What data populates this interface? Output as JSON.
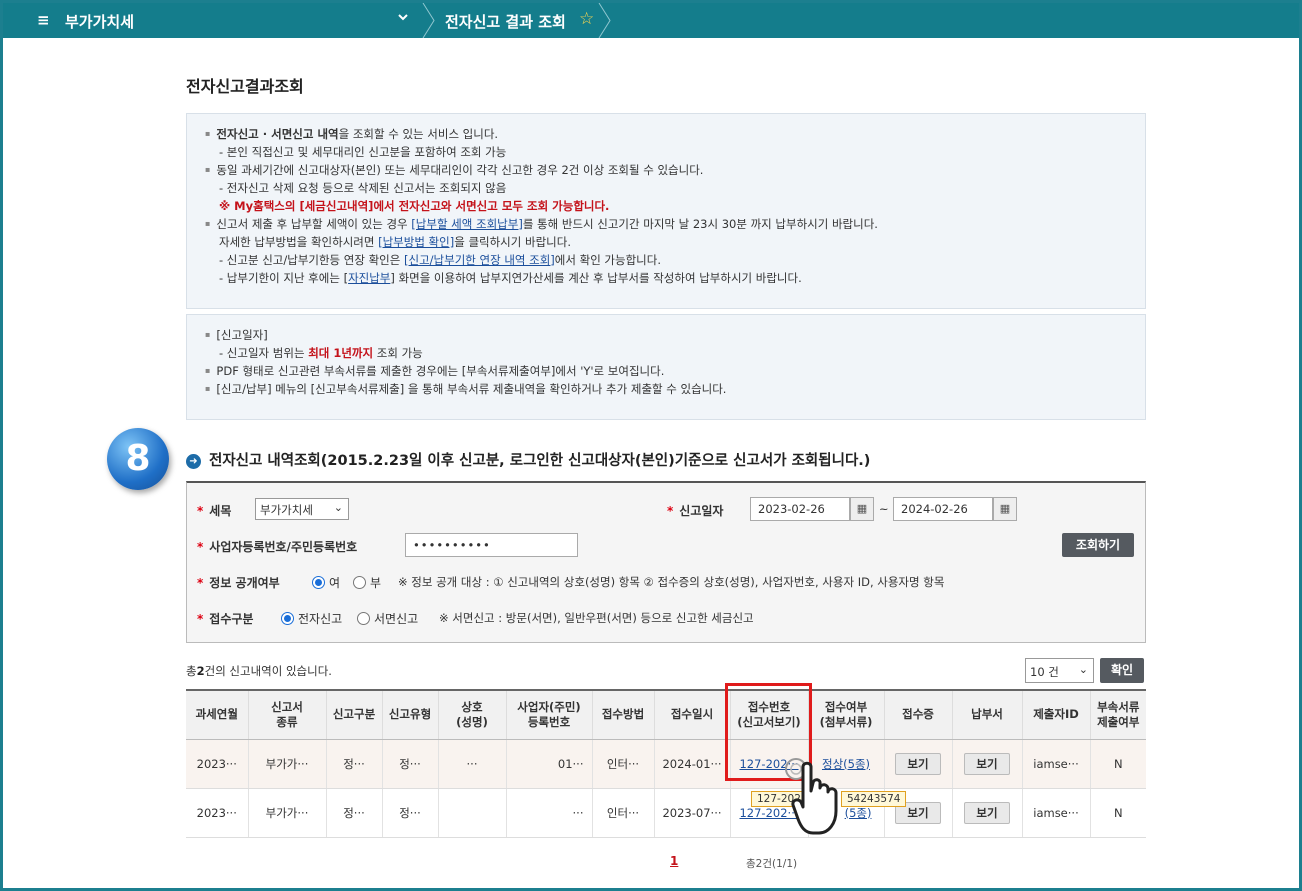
{
  "topbar": {
    "menu_icon": "≡",
    "menu_title": "부가가치세",
    "dropdown_icon": "chevron-down-icon",
    "breadcrumb": "전자신고 결과 조회",
    "star_icon": "☆"
  },
  "page_title": "전자신고결과조회",
  "info1": {
    "l1a": "전자신고 · 서면신고 내역",
    "l1b": "을 조회할 수 있는 서비스 입니다.",
    "l2": "- 본인 직접신고 및 세무대리인 신고분을 포함하여 조회 가능",
    "l3": "동일 과세기간에 신고대상자(본인) 또는 세무대리인이 각각 신고한 경우 2건 이상 조회될 수 있습니다.",
    "l4": "- 전자신고 삭제 요청 등으로 삭제된 신고서는 조회되지 않음",
    "l5": "※ My홈택스의 [세금신고내역]에서 전자신고와 서면신고 모두 조회 가능합니다.",
    "l6a": "신고서 제출 후 납부할 세액이 있는 경우 ",
    "l6link": "[납부할 세액 조회납부]",
    "l6b": "를 통해 반드시 신고기간 마지막 날 23시 30분 까지 납부하시기 바랍니다.",
    "l7a": "자세한 납부방법을 확인하시려면 ",
    "l7link": "[납부방법 확인]",
    "l7b": "을 클릭하시기 바랍니다.",
    "l8a": "- 신고분 신고/납부기한등 연장 확인은 ",
    "l8link": "[신고/납부기한 연장 내역 조회]",
    "l8b": "에서 확인 가능합니다.",
    "l9a": "- 납부기한이 지난 후에는 [",
    "l9link": "자진납부",
    "l9b": "] 화면을 이용하여 납부지연가산세를 계산 후 납부서를 작성하여 납부하시기 바랍니다."
  },
  "info2": {
    "l1": "[신고일자]",
    "l2a": "- 신고일자 범위는 ",
    "l2red": "최대 1년까지",
    "l2b": " 조회 가능",
    "l3": "PDF 형태로 신고관련 부속서류를 제출한 경우에는 [부속서류제출여부]에서 'Y'로 보여집니다.",
    "l4": "[신고/납부] 메뉴의 [신고부속서류제출] 을 통해 부속서류 제출내역을 확인하거나 추가 제출할 수 있습니다."
  },
  "step_badge": "8",
  "section_title": "전자신고 내역조회(2015.2.23일 이후 신고분, 로그인한  신고대상자(본인)기준으로  신고서가 조회됩니다.)",
  "search": {
    "tax_label": "세목",
    "tax_value": "부가가치세",
    "date_label": "신고일자",
    "date_from": "2023-02-26",
    "date_tilde": "~",
    "date_to": "2024-02-26",
    "bizno_label": "사업자등록번호/주민등록번호",
    "bizno_value": "••••••••••",
    "search_button": "조회하기",
    "disclose_label": "정보 공개여부",
    "disclose_yes": "여",
    "disclose_no": "부",
    "disclose_note": "※ 정보 공개 대상 : ① 신고내역의 상호(성명) 항목 ② 접수증의 상호(성명), 사업자번호, 사용자 ID, 사용자명 항목",
    "receipt_label": "접수구분",
    "receipt_e": "전자신고",
    "receipt_paper": "서면신고",
    "receipt_note": "※ 서면신고 : 방문(서면), 일반우편(서면) 등으로 신고한 세금신고"
  },
  "results": {
    "count_prefix": "총",
    "count_num": "2",
    "count_suffix": "건의 신고내역이 있습니다.",
    "page_size": "10 건",
    "confirm_button": "확인",
    "headers": [
      "과세연월",
      "신고서\n종류",
      "신고구분",
      "신고유형",
      "상호\n(성명)",
      "사업자(주민)\n등록번호",
      "접수방법",
      "접수일시",
      "접수번호\n(신고서보기)",
      "접수여부\n(첨부서류)",
      "접수증",
      "납부서",
      "제출자ID",
      "부속서류\n제출여부"
    ],
    "rows": [
      [
        "2023···",
        "부가가···",
        "정···",
        "정···",
        "···",
        "01···",
        "인터···",
        "2024-01···",
        "127-202···",
        "정상(5종)",
        "보기",
        "보기",
        "iamse···",
        "N"
      ],
      [
        "2023···",
        "부가가···",
        "정···",
        "정···",
        "",
        "···",
        "인터···",
        "2023-07···",
        "127-202···",
        "(5종)",
        "보기",
        "보기",
        "iamse···",
        "N"
      ]
    ],
    "tooltip_a": "127-2024",
    "tooltip_b": "54243574",
    "page_current": "1",
    "page_info": "총2건(1/1)"
  },
  "colors": {
    "topbar": "#147d8c",
    "highlight": "#e01b1b",
    "link": "#1b4e9b"
  }
}
